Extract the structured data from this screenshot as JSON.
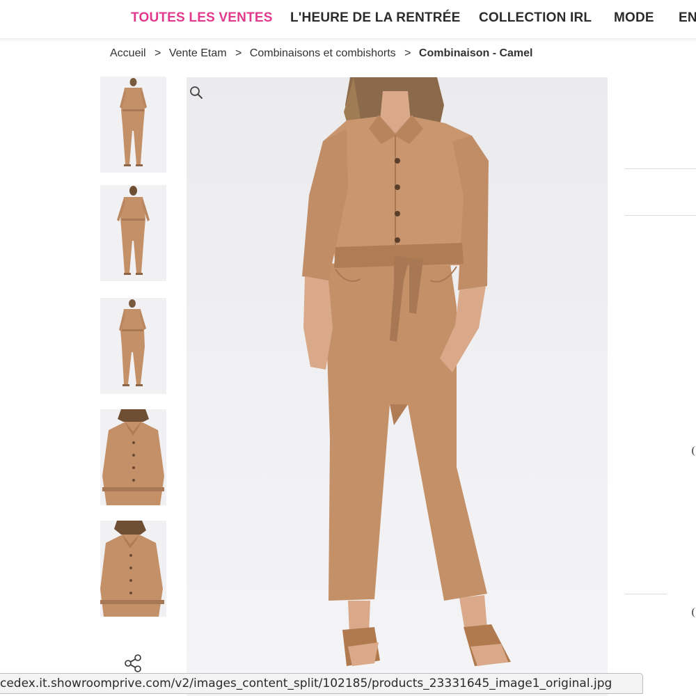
{
  "topnav": {
    "items": [
      {
        "label": "TOUTES LES VENTES",
        "active": true
      },
      {
        "label": "L'HEURE DE LA RENTRÉE"
      },
      {
        "label": "COLLECTION IRL"
      },
      {
        "label": "MODE"
      },
      {
        "label": "EN"
      }
    ],
    "accent_color": "#e2398c"
  },
  "breadcrumb": {
    "items": [
      "Accueil",
      "Vente Etam",
      "Combinaisons et combishorts"
    ],
    "current": "Combinaison - Camel",
    "separator": ">"
  },
  "gallery": {
    "thumbnails": [
      "front-full",
      "back-full",
      "front-full-alt",
      "closeup-bust",
      "closeup-bust-alt"
    ],
    "main_view": "front-full",
    "product_color": "#c49068"
  },
  "icons": {
    "zoom": "magnifier-icon",
    "share": "share-icon"
  },
  "status_bar": {
    "url": "cedex.it.showroomprive.com/v2/images_content_split/102185/products_23331645_image1_original.jpg"
  }
}
